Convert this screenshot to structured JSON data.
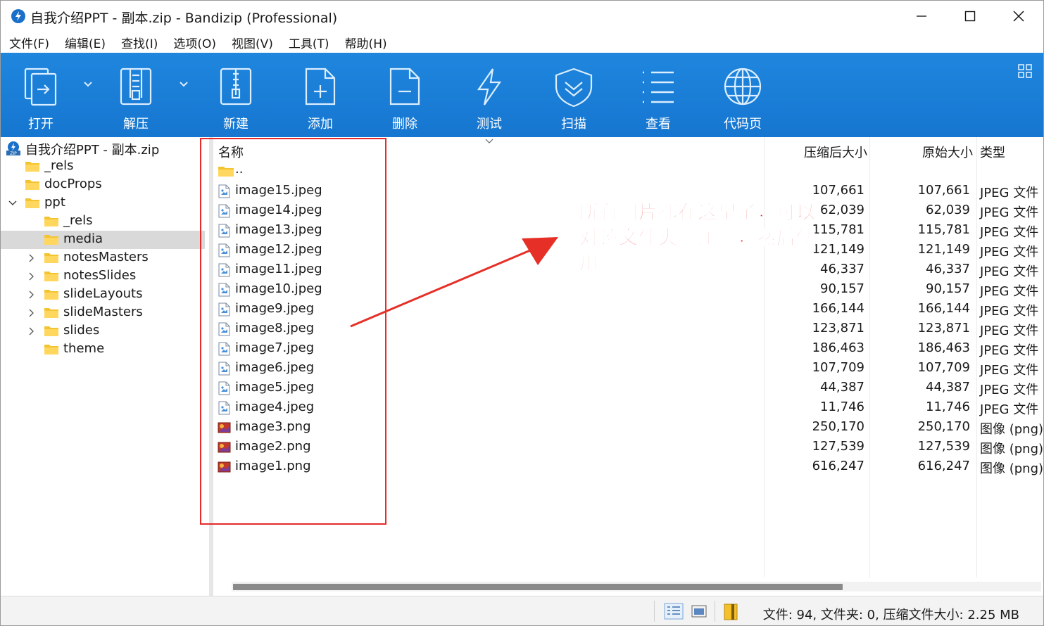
{
  "window": {
    "title": "自我介绍PPT - 副本.zip - Bandizip (Professional)",
    "minimize_icon": "minimize-icon",
    "maximize_icon": "maximize-icon",
    "close_icon": "close-icon"
  },
  "menu": [
    "文件(F)",
    "编辑(E)",
    "查找(I)",
    "选项(O)",
    "视图(V)",
    "工具(T)",
    "帮助(H)"
  ],
  "toolbar": {
    "background": "#1b7fd8",
    "items": [
      {
        "label": "打开",
        "icon": "open-icon"
      },
      {
        "label": "解压",
        "icon": "extract-icon"
      },
      {
        "label": "新建",
        "icon": "new-archive-icon"
      },
      {
        "label": "添加",
        "icon": "add-file-icon"
      },
      {
        "label": "删除",
        "icon": "delete-file-icon"
      },
      {
        "label": "测试",
        "icon": "test-lightning-icon"
      },
      {
        "label": "扫描",
        "icon": "scan-shield-icon"
      },
      {
        "label": "查看",
        "icon": "view-list-icon"
      },
      {
        "label": "代码页",
        "icon": "codepage-globe-icon"
      }
    ]
  },
  "tree": {
    "root": "自我介绍PPT - 副本.zip",
    "items": [
      {
        "label": "_rels",
        "level": 1,
        "toggle": "none"
      },
      {
        "label": "docProps",
        "level": 1,
        "toggle": "none"
      },
      {
        "label": "ppt",
        "level": 1,
        "toggle": "expanded"
      },
      {
        "label": "_rels",
        "level": 2,
        "toggle": "none"
      },
      {
        "label": "media",
        "level": 2,
        "toggle": "none",
        "selected": true
      },
      {
        "label": "notesMasters",
        "level": 2,
        "toggle": "collapsed"
      },
      {
        "label": "notesSlides",
        "level": 2,
        "toggle": "collapsed"
      },
      {
        "label": "slideLayouts",
        "level": 2,
        "toggle": "collapsed"
      },
      {
        "label": "slideMasters",
        "level": 2,
        "toggle": "collapsed"
      },
      {
        "label": "slides",
        "level": 2,
        "toggle": "collapsed"
      },
      {
        "label": "theme",
        "level": 2,
        "toggle": "none"
      }
    ]
  },
  "filelist": {
    "columns": {
      "name": "名称",
      "compressed": "压缩后大小",
      "original": "原始大小",
      "type": "类型"
    },
    "parent": "..",
    "rows": [
      {
        "name": "image15.jpeg",
        "compressed": "107,661",
        "original": "107,661",
        "type": "JPEG 文件",
        "kind": "jpeg"
      },
      {
        "name": "image14.jpeg",
        "compressed": "62,039",
        "original": "62,039",
        "type": "JPEG 文件",
        "kind": "jpeg"
      },
      {
        "name": "image13.jpeg",
        "compressed": "115,781",
        "original": "115,781",
        "type": "JPEG 文件",
        "kind": "jpeg"
      },
      {
        "name": "image12.jpeg",
        "compressed": "121,149",
        "original": "121,149",
        "type": "JPEG 文件",
        "kind": "jpeg"
      },
      {
        "name": "image11.jpeg",
        "compressed": "46,337",
        "original": "46,337",
        "type": "JPEG 文件",
        "kind": "jpeg"
      },
      {
        "name": "image10.jpeg",
        "compressed": "90,157",
        "original": "90,157",
        "type": "JPEG 文件",
        "kind": "jpeg"
      },
      {
        "name": "image9.jpeg",
        "compressed": "166,144",
        "original": "166,144",
        "type": "JPEG 文件",
        "kind": "jpeg"
      },
      {
        "name": "image8.jpeg",
        "compressed": "123,871",
        "original": "123,871",
        "type": "JPEG 文件",
        "kind": "jpeg"
      },
      {
        "name": "image7.jpeg",
        "compressed": "186,463",
        "original": "186,463",
        "type": "JPEG 文件",
        "kind": "jpeg"
      },
      {
        "name": "image6.jpeg",
        "compressed": "107,709",
        "original": "107,709",
        "type": "JPEG 文件",
        "kind": "jpeg"
      },
      {
        "name": "image5.jpeg",
        "compressed": "44,387",
        "original": "44,387",
        "type": "JPEG 文件",
        "kind": "jpeg"
      },
      {
        "name": "image4.jpeg",
        "compressed": "11,746",
        "original": "11,746",
        "type": "JPEG 文件",
        "kind": "jpeg"
      },
      {
        "name": "image3.png",
        "compressed": "250,170",
        "original": "250,170",
        "type": "图像 (png)",
        "kind": "png"
      },
      {
        "name": "image2.png",
        "compressed": "127,539",
        "original": "127,539",
        "type": "图像 (png)",
        "kind": "png"
      },
      {
        "name": "image1.png",
        "compressed": "616,247",
        "original": "616,247",
        "type": "图像 (png)",
        "kind": "png"
      }
    ]
  },
  "status": {
    "text": "文件: 94, 文件夹: 0, 压缩文件大小: 2.25 MB"
  },
  "annotation": {
    "text": "所有图片都在这里了，可以对该文件夹解压缩，然后使用",
    "color": "#ef2a2a"
  }
}
